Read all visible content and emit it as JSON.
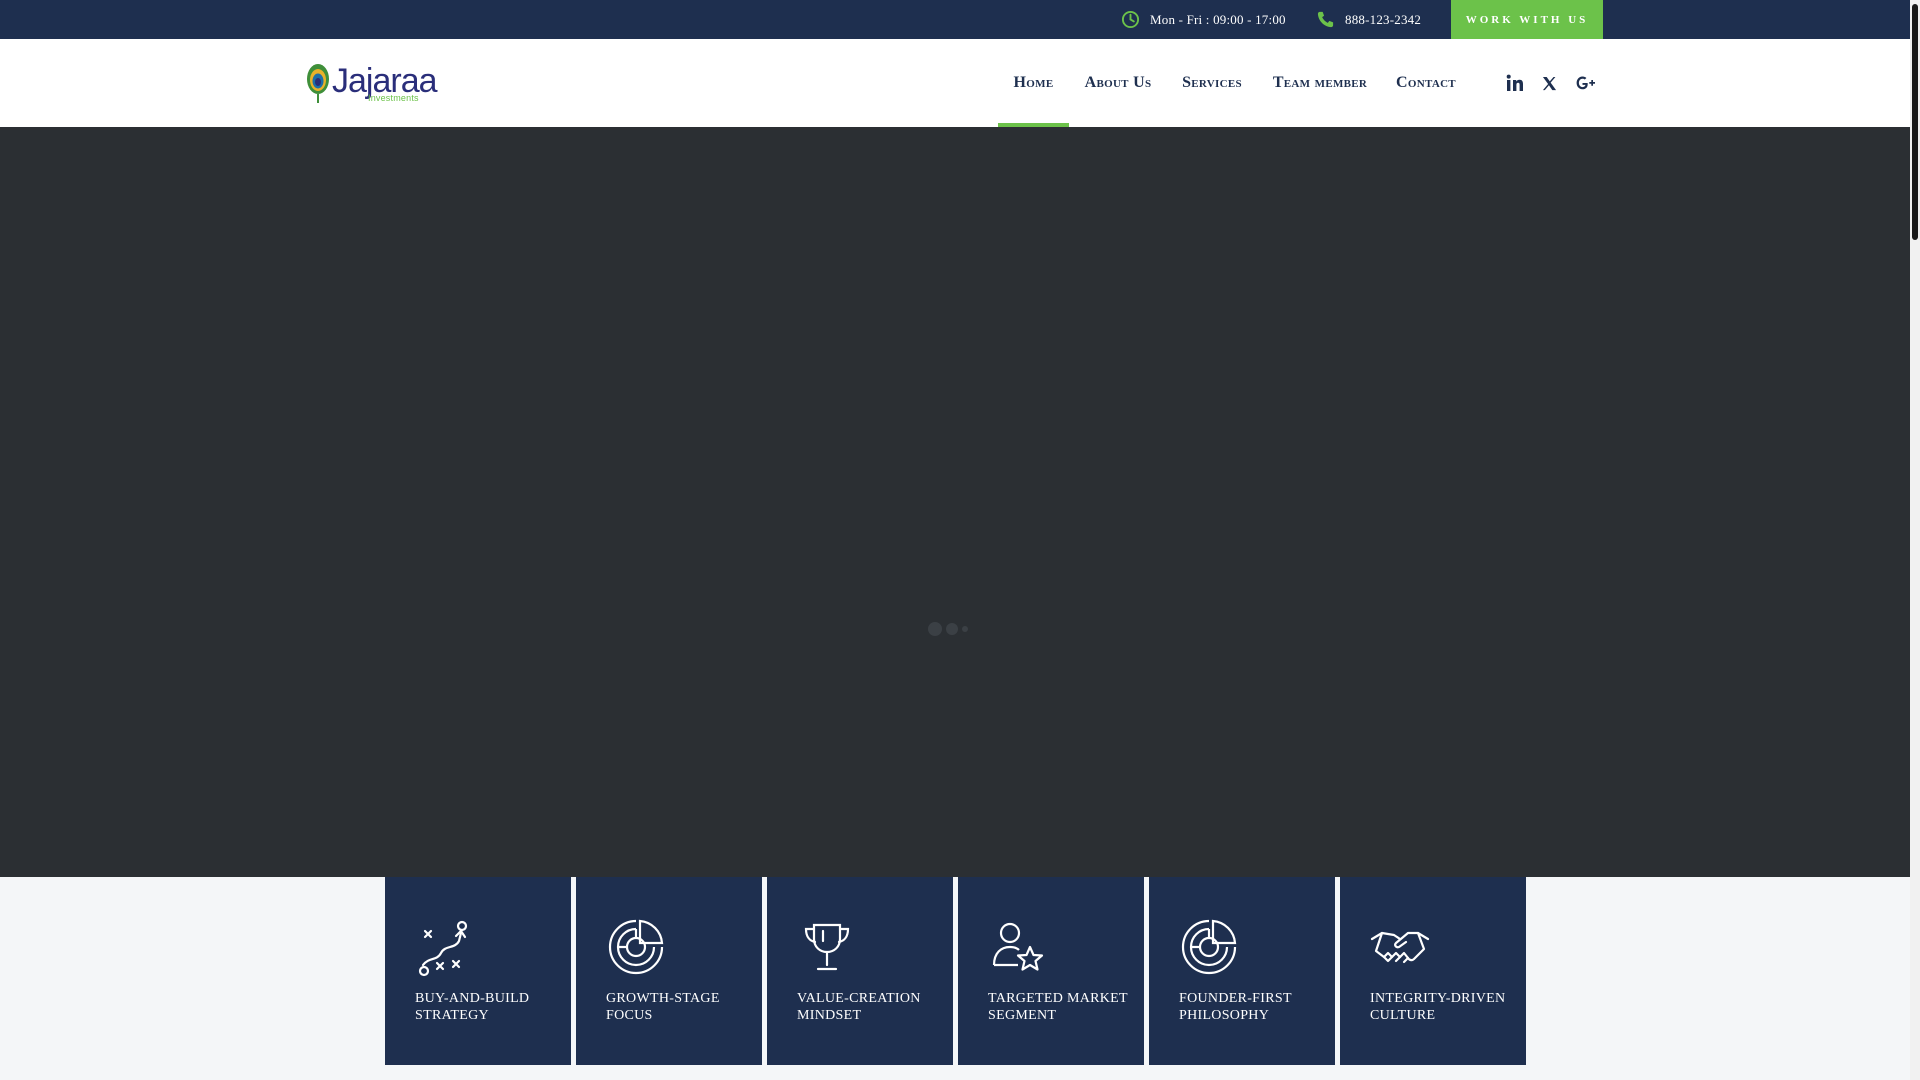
{
  "topbar": {
    "hours": "Mon - Fri : 09:00 - 17:00",
    "hours_icon": "clock-icon",
    "phone": "888-123-2342",
    "phone_icon": "phone-icon",
    "cta_label": "WORK WITH US"
  },
  "brand": {
    "name": "Jajaraa",
    "tagline": "Investments"
  },
  "nav": {
    "items": [
      {
        "label": "Home",
        "active": true
      },
      {
        "label": "About Us",
        "active": false
      },
      {
        "label": "Services",
        "active": false
      },
      {
        "label": "Team member",
        "active": false
      },
      {
        "label": "Contact",
        "active": false
      }
    ],
    "social": [
      "linkedin-icon",
      "x-twitter-icon",
      "google-plus-icon"
    ]
  },
  "hero": {
    "state": "loading",
    "loader_icon": "loading-dots-icon"
  },
  "features": [
    {
      "label": "BUY-AND-BUILD STRATEGY",
      "icon": "strategy-play-icon"
    },
    {
      "label": "GROWTH-STAGE FOCUS",
      "icon": "pie-chart-icon"
    },
    {
      "label": "VALUE-CREATION MINDSET",
      "icon": "trophy-icon"
    },
    {
      "label": "TARGETED MARKET SEGMENT",
      "icon": "user-star-icon"
    },
    {
      "label": "FOUNDER-FIRST PHILOSOPHY",
      "icon": "pie-chart-icon"
    },
    {
      "label": "INTEGRITY-DRIVEN CULTURE",
      "icon": "handshake-icon"
    }
  ],
  "colors": {
    "navy": "#1e2f4f",
    "accent_green": "#6cc24a",
    "hero_bg": "#2b2f33"
  }
}
